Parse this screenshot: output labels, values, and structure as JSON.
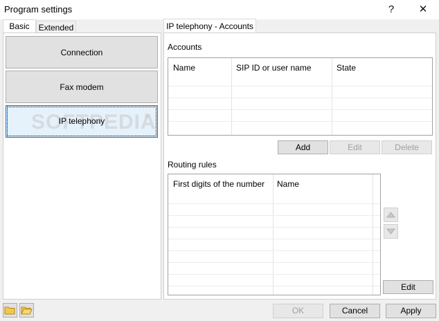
{
  "window": {
    "title": "Program settings",
    "help_label": "?",
    "close_label": "✕"
  },
  "left_tabs": [
    {
      "label": "Basic"
    },
    {
      "label": "Extended"
    }
  ],
  "nav_items": [
    {
      "label": "Connection"
    },
    {
      "label": "Fax modem"
    },
    {
      "label": "IP telephony"
    }
  ],
  "watermark": "SOFTPEDIA",
  "watermark_mark": "®",
  "right_tab": {
    "label": "IP telephony - Accounts"
  },
  "accounts": {
    "title": "Accounts",
    "columns": [
      "Name",
      "SIP ID or user name",
      "State"
    ],
    "buttons": {
      "add": "Add",
      "edit": "Edit",
      "delete": "Delete"
    }
  },
  "routing": {
    "title": "Routing rules",
    "columns": [
      "First digits of the number",
      "Name"
    ],
    "edit_label": "Edit",
    "up_icon": "up-triangle-icon",
    "down_icon": "down-triangle-icon"
  },
  "footer": {
    "ok": "OK",
    "cancel": "Cancel",
    "apply": "Apply"
  },
  "colors": {
    "accent": "#0078d7",
    "selected_bg": "#e5f1fb"
  }
}
